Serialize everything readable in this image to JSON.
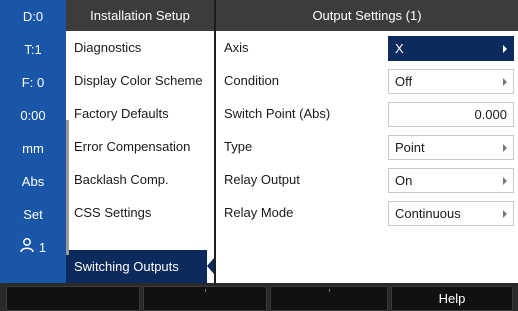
{
  "status_bar": {
    "datum": "D:0",
    "tool": "T:1",
    "feed": "F:  0",
    "timer": "0:00",
    "units": "mm",
    "mode": "Abs",
    "set": "Set",
    "user": "1"
  },
  "menu": {
    "header": "Installation Setup",
    "items": [
      {
        "label": "Diagnostics"
      },
      {
        "label": "Display Color Scheme"
      },
      {
        "label": "Factory Defaults"
      },
      {
        "label": "Error Compensation"
      },
      {
        "label": "Backlash Comp."
      },
      {
        "label": "CSS Settings"
      },
      {
        "label": "Switching Outputs",
        "selected": true
      }
    ]
  },
  "panel": {
    "header": "Output Settings (1)",
    "rows": [
      {
        "label": "Axis",
        "value": "X",
        "active": true,
        "dropdown": true
      },
      {
        "label": "Condition",
        "value": "Off",
        "dropdown": true
      },
      {
        "label": "Switch Point (Abs)",
        "value": "0.000",
        "dropdown": false
      },
      {
        "label": "Type",
        "value": "Point",
        "dropdown": true
      },
      {
        "label": "Relay Output",
        "value": "On",
        "dropdown": true
      },
      {
        "label": "Relay Mode",
        "value": "Continuous",
        "dropdown": true
      }
    ]
  },
  "softkeys": [
    "",
    "",
    "",
    "Help"
  ],
  "colors": {
    "status_bar_bg": "#1a56a8",
    "header_bg": "#3c3c3c",
    "selected_bg": "#0d2a5c"
  }
}
